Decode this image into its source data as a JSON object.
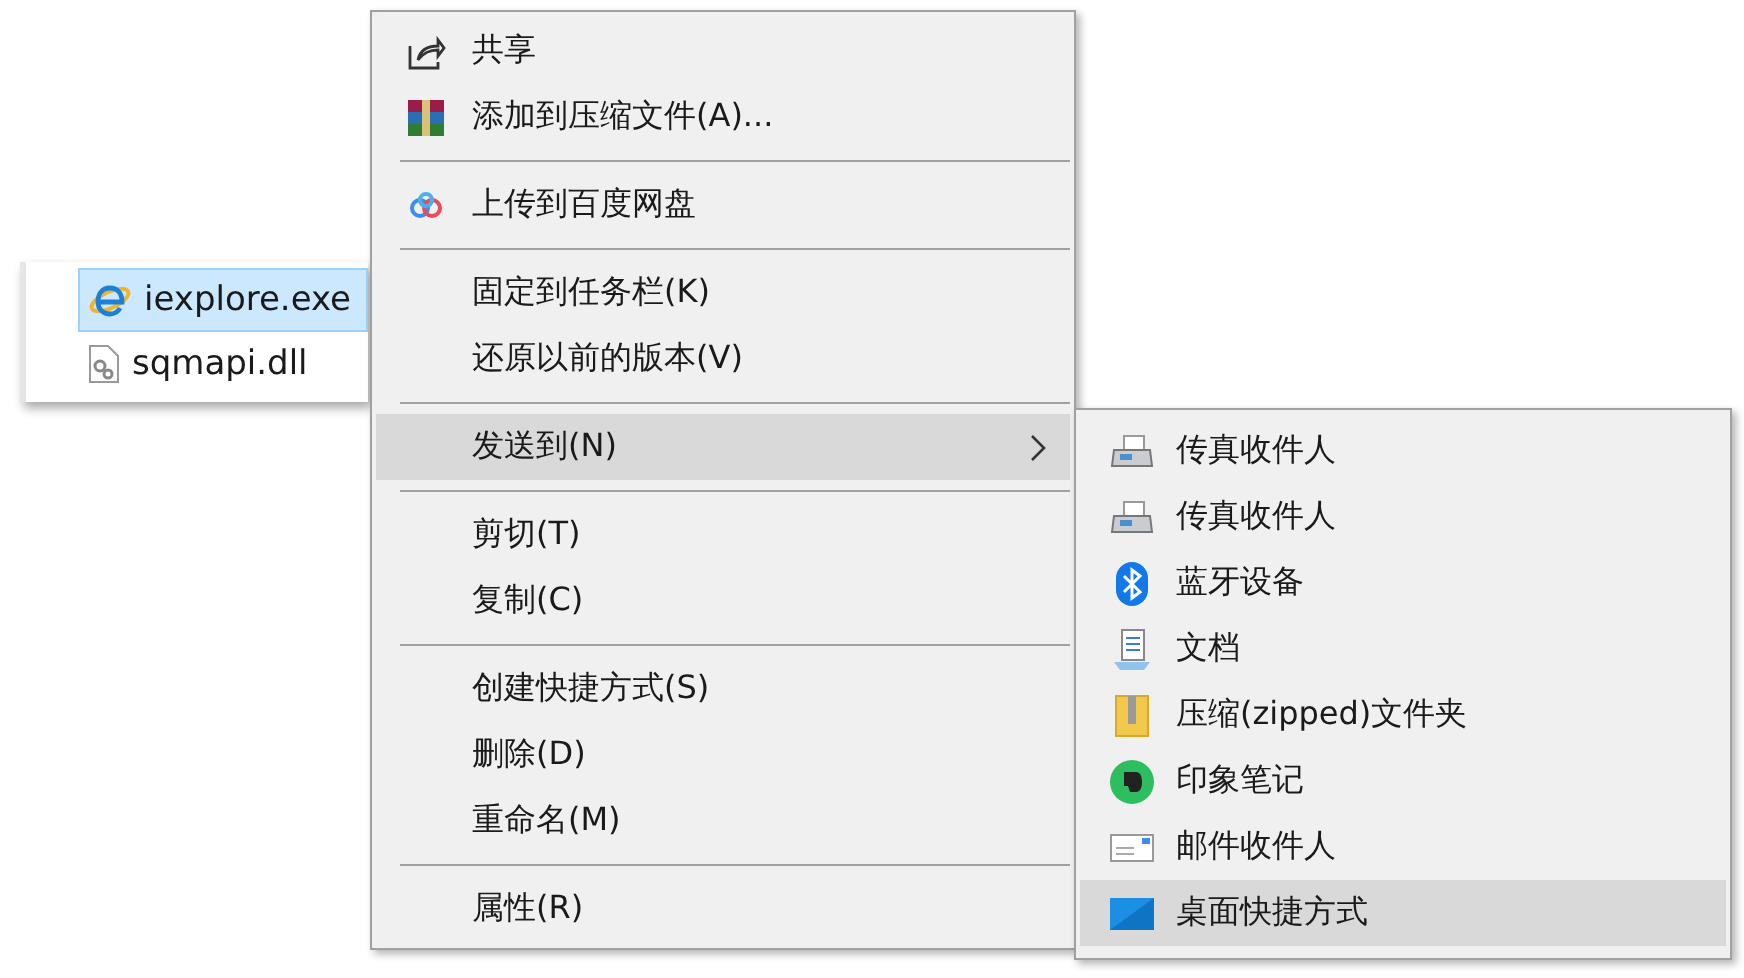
{
  "file_list": {
    "items": [
      {
        "name": "iexplore.exe",
        "selected": true
      },
      {
        "name": "sqmapi.dll",
        "selected": false
      }
    ]
  },
  "context_menu": {
    "items": [
      {
        "kind": "item",
        "label": "共享",
        "selected": false,
        "has_submenu": false
      },
      {
        "kind": "item",
        "label": "添加到压缩文件(A)...",
        "selected": false,
        "has_submenu": false
      },
      {
        "kind": "separator"
      },
      {
        "kind": "item",
        "label": "上传到百度网盘",
        "selected": false,
        "has_submenu": false
      },
      {
        "kind": "separator"
      },
      {
        "kind": "item",
        "label": "固定到任务栏(K)",
        "selected": false,
        "has_submenu": false
      },
      {
        "kind": "item",
        "label": "还原以前的版本(V)",
        "selected": false,
        "has_submenu": false
      },
      {
        "kind": "separator"
      },
      {
        "kind": "item",
        "label": "发送到(N)",
        "selected": true,
        "has_submenu": true
      },
      {
        "kind": "separator"
      },
      {
        "kind": "item",
        "label": "剪切(T)",
        "selected": false,
        "has_submenu": false
      },
      {
        "kind": "item",
        "label": "复制(C)",
        "selected": false,
        "has_submenu": false
      },
      {
        "kind": "separator"
      },
      {
        "kind": "item",
        "label": "创建快捷方式(S)",
        "selected": false,
        "has_submenu": false
      },
      {
        "kind": "item",
        "label": "删除(D)",
        "selected": false,
        "has_submenu": false
      },
      {
        "kind": "item",
        "label": "重命名(M)",
        "selected": false,
        "has_submenu": false
      },
      {
        "kind": "separator"
      },
      {
        "kind": "item",
        "label": "属性(R)",
        "selected": false,
        "has_submenu": false
      }
    ]
  },
  "submenu": {
    "items": [
      {
        "label": "传真收件人",
        "selected": false
      },
      {
        "label": "传真收件人",
        "selected": false
      },
      {
        "label": "蓝牙设备",
        "selected": false
      },
      {
        "label": "文档",
        "selected": false
      },
      {
        "label": "压缩(zipped)文件夹",
        "selected": false
      },
      {
        "label": "印象笔记",
        "selected": false
      },
      {
        "label": "邮件收件人",
        "selected": false
      },
      {
        "label": "桌面快捷方式",
        "selected": true
      }
    ]
  }
}
